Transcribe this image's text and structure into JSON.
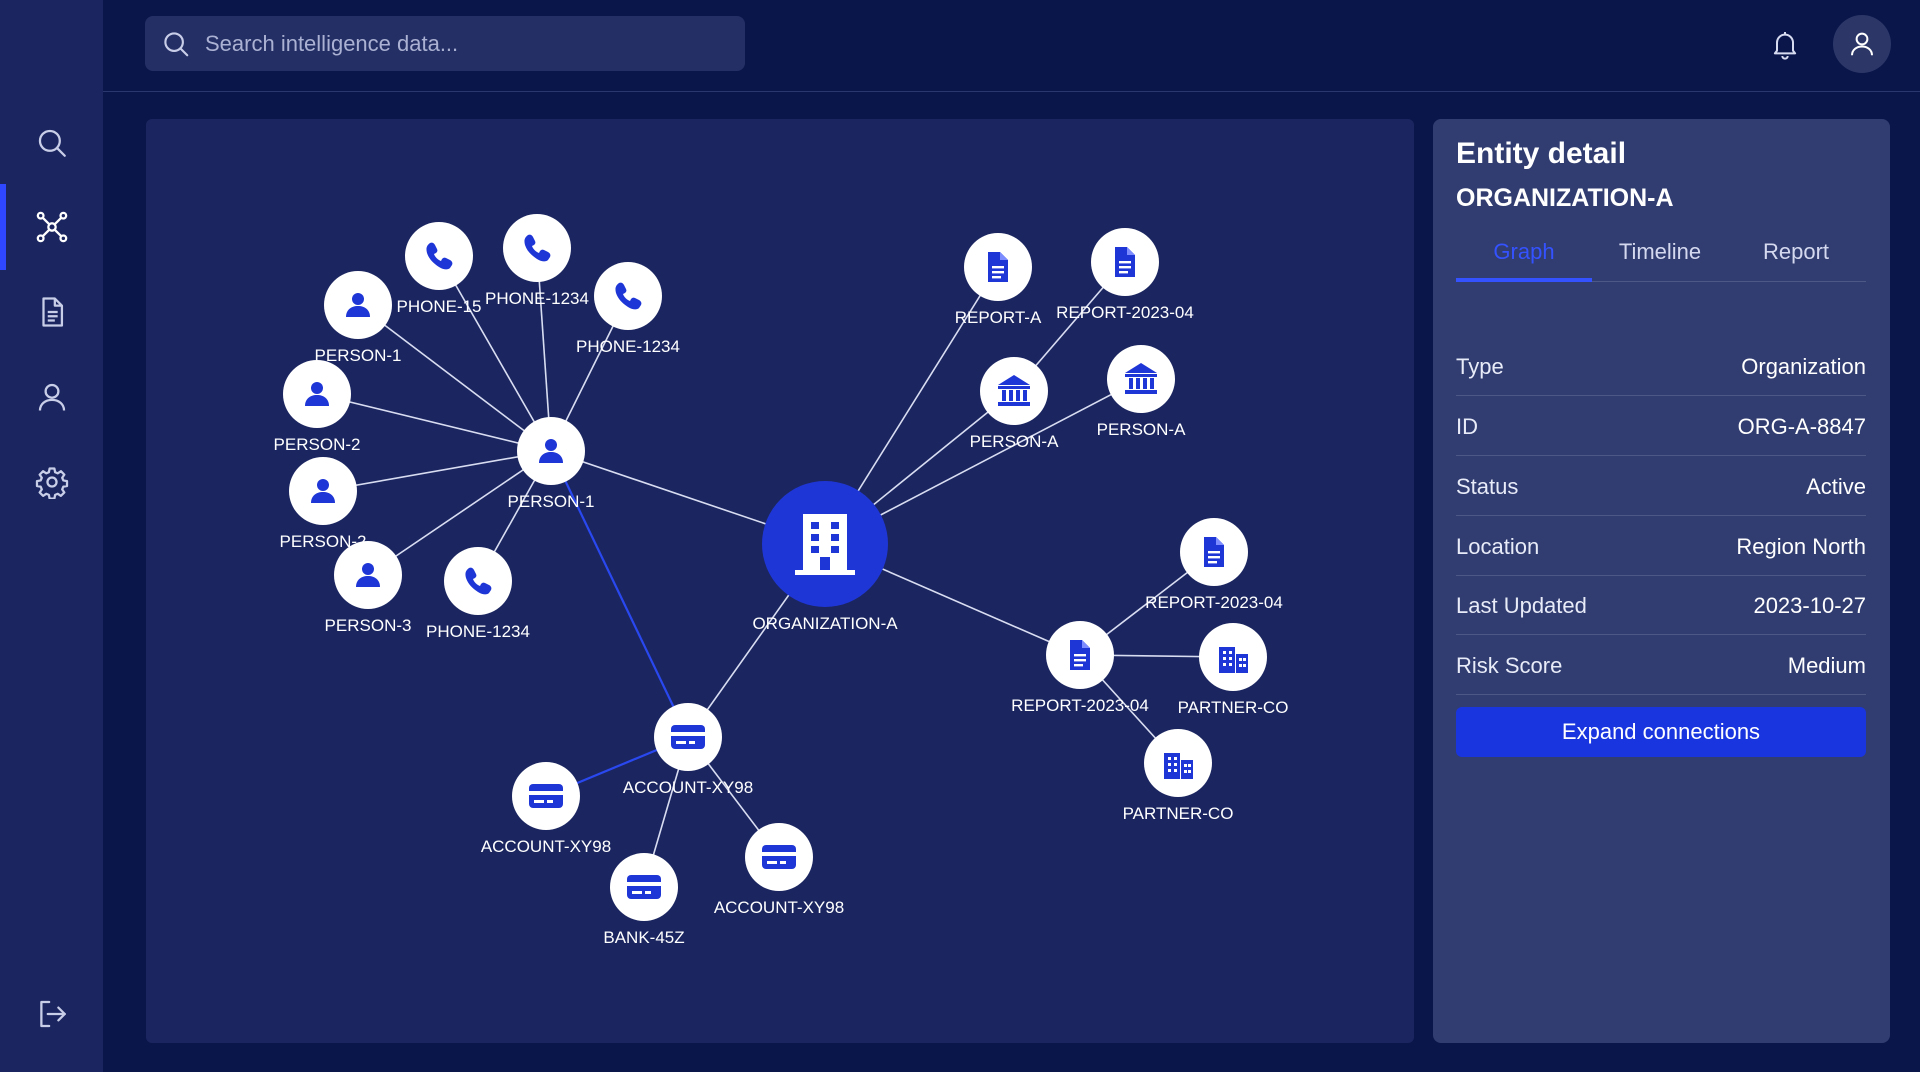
{
  "search": {
    "placeholder": "Search intelligence data..."
  },
  "sidebar": {
    "items": [
      {
        "icon": "search-icon",
        "active": false
      },
      {
        "icon": "network-graph-icon",
        "active": true
      },
      {
        "icon": "document-icon",
        "active": false
      },
      {
        "icon": "user-icon",
        "active": false
      },
      {
        "icon": "gear-icon",
        "active": false
      }
    ],
    "logout_icon": "logout-icon"
  },
  "header": {
    "bell_icon": "bell-icon",
    "avatar_icon": "user-icon"
  },
  "graph": {
    "nodes": [
      {
        "id": "org",
        "label": "ORGANIZATION-A",
        "icon": "building",
        "main": true
      },
      {
        "id": "p1c",
        "label": "PERSON-1",
        "icon": "person"
      },
      {
        "id": "p1t",
        "label": "PERSON-1",
        "icon": "person"
      },
      {
        "id": "p2a",
        "label": "PERSON-2",
        "icon": "person"
      },
      {
        "id": "p2b",
        "label": "PERSON-2",
        "icon": "person"
      },
      {
        "id": "p3",
        "label": "PERSON-3",
        "icon": "person"
      },
      {
        "id": "ph15",
        "label": "PHONE-15",
        "icon": "phone"
      },
      {
        "id": "ph1234a",
        "label": "PHONE-1234",
        "icon": "phone"
      },
      {
        "id": "ph1234b",
        "label": "PHONE-1234",
        "icon": "phone"
      },
      {
        "id": "ph1234c",
        "label": "PHONE-1234",
        "icon": "phone"
      },
      {
        "id": "repA",
        "label": "REPORT-A",
        "icon": "document"
      },
      {
        "id": "rep0404a",
        "label": "REPORT-2023-04",
        "icon": "document"
      },
      {
        "id": "bankA1",
        "label": "PERSON-A",
        "icon": "bank"
      },
      {
        "id": "bankA2",
        "label": "PERSON-A",
        "icon": "bank"
      },
      {
        "id": "rep0404b",
        "label": "REPORT-2023-04",
        "icon": "document"
      },
      {
        "id": "rep0404c",
        "label": "REPORT-2023-04",
        "icon": "document"
      },
      {
        "id": "partner1",
        "label": "PARTNER-CO",
        "icon": "company"
      },
      {
        "id": "partner2",
        "label": "PARTNER-CO",
        "icon": "company"
      },
      {
        "id": "acc1",
        "label": "ACCOUNT-XY98",
        "icon": "card"
      },
      {
        "id": "acc2",
        "label": "ACCOUNT-XY98",
        "icon": "card"
      },
      {
        "id": "acc3",
        "label": "ACCOUNT-XY98",
        "icon": "card"
      },
      {
        "id": "bank45z",
        "label": "BANK-45Z",
        "icon": "card"
      }
    ],
    "edges": [
      [
        "p1c",
        "org"
      ],
      [
        "p1c",
        "p1t"
      ],
      [
        "p1c",
        "ph15"
      ],
      [
        "p1c",
        "ph1234a"
      ],
      [
        "p1c",
        "ph1234b"
      ],
      [
        "p1c",
        "p2a"
      ],
      [
        "p1c",
        "p2b"
      ],
      [
        "p1c",
        "p3"
      ],
      [
        "p1c",
        "ph1234c"
      ],
      [
        "p1c",
        "acc1",
        "highlight"
      ],
      [
        "org",
        "repA"
      ],
      [
        "org",
        "bankA1"
      ],
      [
        "org",
        "bankA2"
      ],
      [
        "org",
        "rep0404c"
      ],
      [
        "org",
        "acc1"
      ],
      [
        "bankA1",
        "rep0404a"
      ],
      [
        "rep0404c",
        "rep0404b"
      ],
      [
        "rep0404c",
        "partner1"
      ],
      [
        "rep0404c",
        "partner2"
      ],
      [
        "acc1",
        "acc2",
        "highlight"
      ],
      [
        "acc1",
        "bank45z"
      ],
      [
        "acc1",
        "acc3"
      ]
    ]
  },
  "detail": {
    "title": "Entity detail",
    "subtitle": "ORGANIZATION-A",
    "tabs": [
      "Graph",
      "Timeline",
      "Report"
    ],
    "active_tab": "Graph",
    "rows": [
      {
        "key": "Type",
        "value": "Organization"
      },
      {
        "key": "ID",
        "value": "ORG-A-8847"
      },
      {
        "key": "Status",
        "value": "Active"
      },
      {
        "key": "Location",
        "value": "Region North"
      },
      {
        "key": "Last Updated",
        "value": "2023-10-27"
      },
      {
        "key": "Risk Score",
        "value": "Medium"
      }
    ],
    "button": "Expand connections"
  },
  "colors": {
    "background": "#0a154a",
    "panel": "#1b2660",
    "detail_panel": "#313d70",
    "accent": "#1935e0",
    "node_fill": "#ffffff",
    "icon_color": "#1f36d6"
  }
}
